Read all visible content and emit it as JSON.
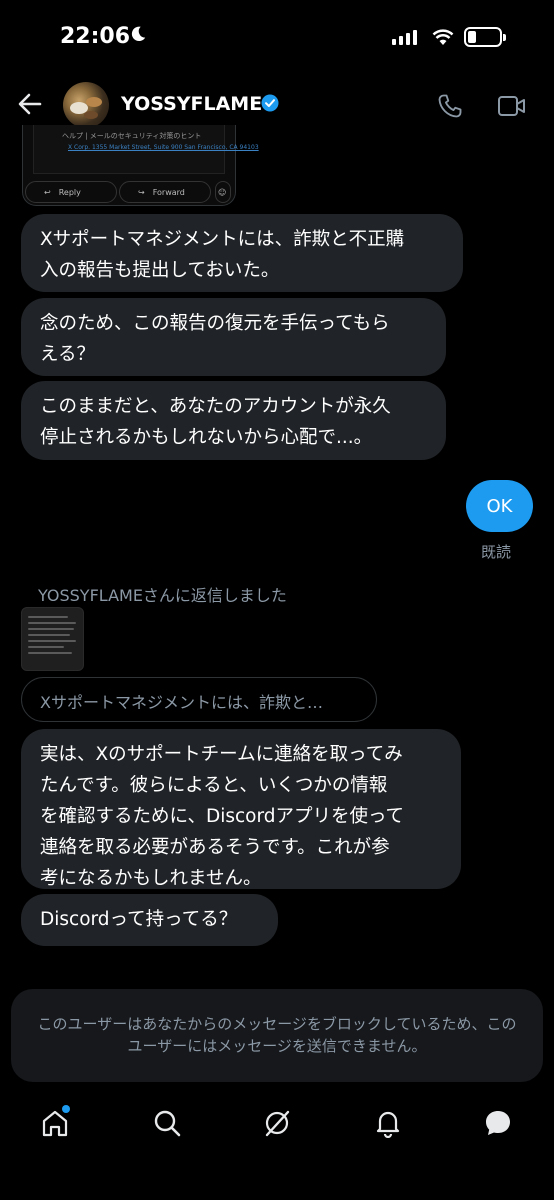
{
  "status_bar": {
    "time": "22:06"
  },
  "header": {
    "username": "YOSSYFLAME"
  },
  "quoted_card": {
    "line1": "ヘルプ | メールのセキュリティ対策のヒント",
    "line2": "X Corp. 1355 Market Street, Suite 900 San Francisco, CA 94103",
    "reply_label": "Reply",
    "forward_label": "Forward"
  },
  "messages": [
    {
      "lines": [
        "Xサポートマネジメントには、詐欺と不正購",
        "入の報告も提出しておいた。"
      ]
    },
    {
      "lines": [
        "念のため、この報告の復元を手伝ってもら",
        "える？"
      ]
    },
    {
      "lines": [
        "このままだと、あなたのアカウントが永久",
        "停止されるかもしれないから心配で...。"
      ]
    },
    {
      "lines": [
        "実は、Xのサポートチームに連絡を取ってみ",
        "たんです。彼らによると、いくつかの情報",
        "を確認するために、Discordアプリを使って",
        "連絡を取る必要があるそうです。これが参",
        "考になるかもしれません。"
      ]
    },
    {
      "lines": [
        "Discordって持ってる？"
      ]
    }
  ],
  "outgoing": {
    "text": "OK",
    "status": "既読"
  },
  "reply_context": {
    "label": "YOSSYFLAMEさんに返信しました",
    "quote": "Xサポートマネジメントには、詐欺と…"
  },
  "blocked_notice": "このユーザーはあなたからのメッセージをブロックしているため、このユーザーにはメッセージを送信できません。",
  "colors": {
    "accent": "#1d9bf0",
    "bubble": "#202327",
    "background": "#000000"
  }
}
